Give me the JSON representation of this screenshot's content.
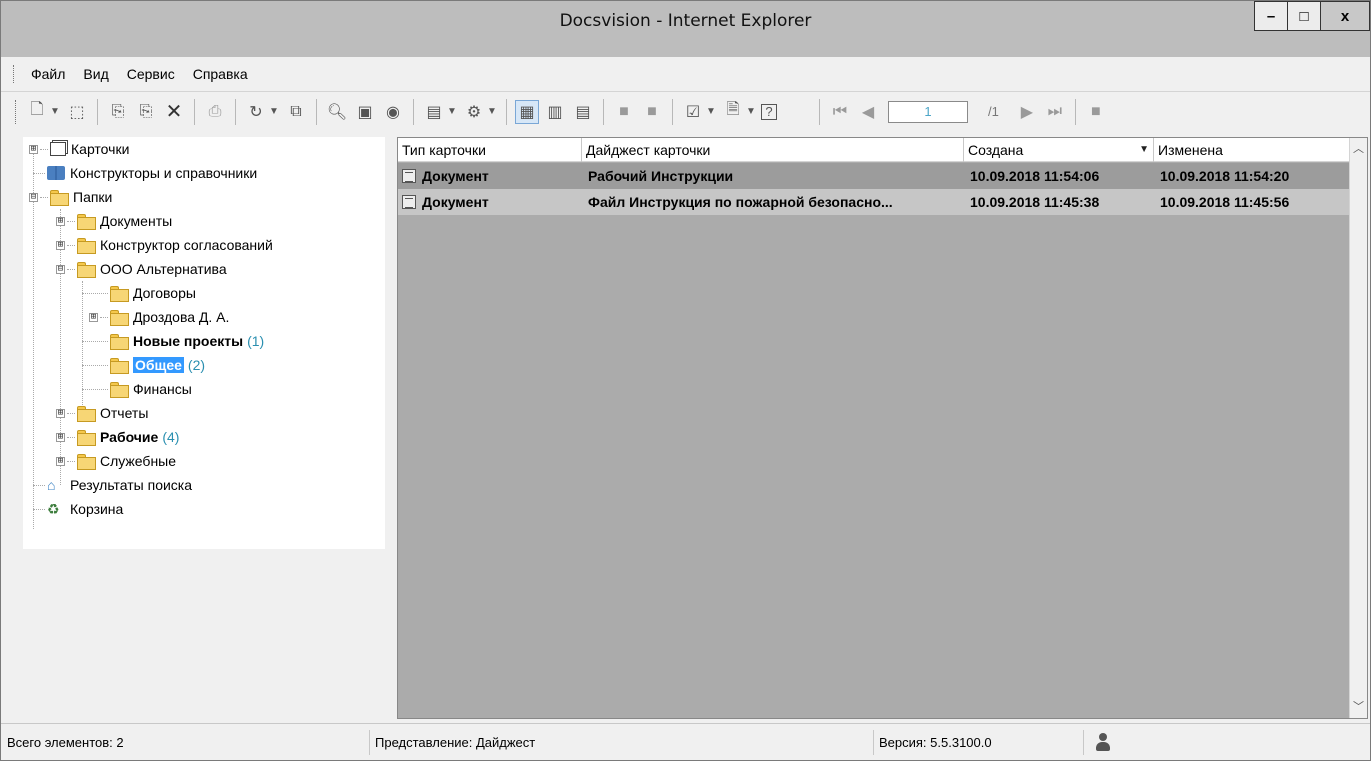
{
  "window": {
    "title": "Docsvision - Internet Explorer",
    "minimize_label": "–",
    "maximize_label": "□",
    "close_label": "x"
  },
  "menu": {
    "items": [
      "Файл",
      "Вид",
      "Сервис",
      "Справка"
    ]
  },
  "pager": {
    "current_page": "1",
    "total": "/1"
  },
  "tree": {
    "nodes": [
      {
        "label": "Карточки",
        "icon": "cards-icon"
      },
      {
        "label": "Конструкторы и справочники",
        "icon": "book-icon"
      },
      {
        "label": "Папки",
        "icon": "folder-icon"
      },
      {
        "label": "Документы",
        "icon": "folder-icon"
      },
      {
        "label": "Конструктор согласований",
        "icon": "folder-icon"
      },
      {
        "label": "ООО Альтернатива",
        "icon": "folder-icon"
      },
      {
        "label": "Договоры",
        "icon": "folder-icon"
      },
      {
        "label": "Дроздова Д. А.",
        "icon": "folder-icon"
      },
      {
        "label": "Новые проекты",
        "count": "(1)",
        "icon": "folder-icon"
      },
      {
        "label": "Общее",
        "count": "(2)",
        "icon": "folder-open-icon",
        "selected": true
      },
      {
        "label": "Финансы",
        "icon": "folder-icon"
      },
      {
        "label": "Отчеты",
        "icon": "folder-icon"
      },
      {
        "label": "Рабочие",
        "count": "(4)",
        "icon": "folder-icon"
      },
      {
        "label": "Служебные",
        "icon": "folder-icon"
      },
      {
        "label": "Результаты поиска",
        "icon": "search-results-icon"
      },
      {
        "label": "Корзина",
        "icon": "recycle-bin-icon"
      }
    ],
    "expanders": [
      "⊞",
      "⊟",
      "⊞",
      "⊞",
      "⊟",
      "⊞",
      "⊞",
      "⊞",
      "⊞"
    ]
  },
  "grid": {
    "columns": [
      "Тип карточки",
      "Дайджест карточки",
      "Создана",
      "Изменена"
    ],
    "sort_indicator": "▼",
    "rows": [
      {
        "type": "Документ",
        "digest": "Рабочий Инструкции",
        "created": "10.09.2018 11:54:06",
        "modified": "10.09.2018 11:54:20"
      },
      {
        "type": "Документ",
        "digest": "Файл Инструкция по пожарной безопасно...",
        "created": "10.09.2018 11:45:38",
        "modified": "10.09.2018 11:45:56"
      }
    ]
  },
  "status": {
    "total": "Всего элементов: 2",
    "view": "Представление: Дайджест",
    "version": "Версия: 5.5.3100.0"
  },
  "colors": {
    "selection": "#3399ff",
    "count": "#2a8fb0",
    "grid_background": "#ababab"
  }
}
